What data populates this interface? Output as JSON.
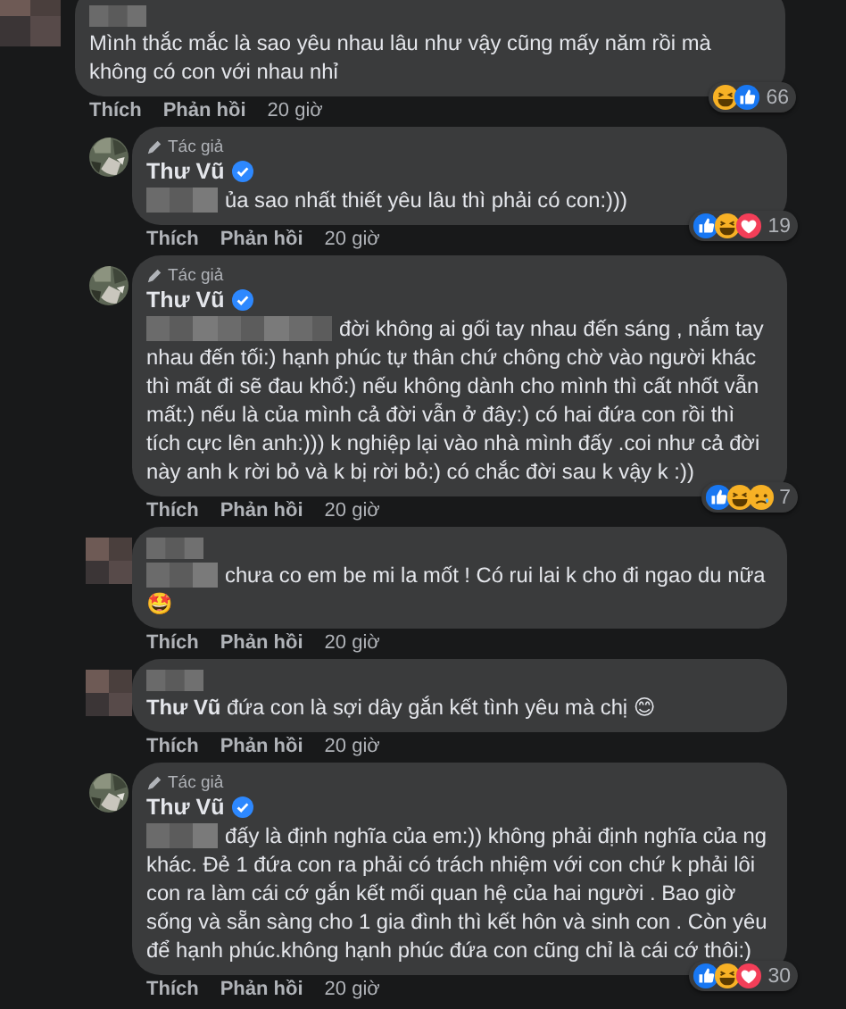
{
  "comments": [
    {
      "kind": "top",
      "avatar": {
        "kind": "mosaic"
      },
      "name_mosaic": true,
      "verified": false,
      "text": "Mình thắc mắc là sao yêu nhau lâu như vậy cũng mấy năm rồi mà không có con với nhau nhỉ",
      "reactions": [
        {
          "kind": "haha"
        },
        {
          "kind": "like"
        }
      ],
      "reaction_count": "66",
      "actions": [
        "Thích",
        "Phản hồi",
        "20 giờ"
      ]
    },
    {
      "kind": "reply",
      "name_mosaic": false,
      "author": "Thư Vũ",
      "author_badge": "Tác giả",
      "verified": true,
      "text_mosaic": {
        "kind": "short"
      },
      "text": "ủa sao nhất thiết yêu lâu thì phải có con:)))",
      "reactions": [
        {
          "kind": "like"
        },
        {
          "kind": "haha"
        },
        {
          "kind": "love"
        }
      ],
      "reaction_count": "19",
      "actions": [
        "Thích",
        "Phản hồi",
        "20 giờ"
      ]
    },
    {
      "kind": "reply",
      "name_mosaic": false,
      "author": "Thư Vũ",
      "author_badge": "Tác giả",
      "verified": true,
      "text_mosaic": {
        "kind": "long"
      },
      "text": "đời không ai gối tay nhau đến sáng , nắm tay nhau đến tối:) hạnh phúc tự thân chứ chông chờ vào người khác thì mất đi sẽ đau khổ:) nếu không dành cho mình thì cất nhốt vẫn mất:) nếu là của mình cả đời vẫn ở đây:) có hai đứa con rồi thì tích cực lên anh:))) k nghiệp lại vào nhà mình đấy .coi như cả đời này anh k rời bỏ và k bị rời bỏ:) có chắc đời sau k vậy k :))",
      "reactions": [
        {
          "kind": "like"
        },
        {
          "kind": "haha"
        },
        {
          "kind": "sad"
        }
      ],
      "reaction_count": "7",
      "actions": [
        "Thích",
        "Phản hồi",
        "20 giờ"
      ]
    },
    {
      "kind": "reply",
      "avatar": {
        "kind": "mosaic"
      },
      "name_mosaic": true,
      "verified": false,
      "text_mosaic": {
        "kind": "short"
      },
      "text": "chưa co em be mi la mốt ! Có rui lai k cho đi ngao du nữa🤩",
      "actions": [
        "Thích",
        "Phản hồi",
        "20 giờ"
      ]
    },
    {
      "kind": "reply",
      "avatar": {
        "kind": "mosaic"
      },
      "name_mosaic": true,
      "verified": false,
      "text": "**Thư Vũ** đứa con là sợi dây gắn kết tình yêu mà chị 😊",
      "actions": [
        "Thích",
        "Phản hồi",
        "20 giờ"
      ]
    },
    {
      "kind": "reply",
      "name_mosaic": false,
      "author": "Thư Vũ",
      "author_badge": "Tác giả",
      "verified": true,
      "text_mosaic": {
        "kind": "short"
      },
      "text": "đấy là định nghĩa của em:)) không phải định nghĩa của ng khác. Đẻ 1 đứa con ra phải có trách nhiệm với con chứ k phải lôi con ra làm cái cớ gắn kết mối quan hệ của hai người . Bao giờ sống và sẵn sàng cho 1 gia đình thì kết hôn và sinh con . Còn yêu để hạnh phúc.không hạnh phúc đứa con cũng chỉ là cái cớ thôi:)",
      "reactions": [
        {
          "kind": "like"
        },
        {
          "kind": "haha"
        },
        {
          "kind": "love"
        }
      ],
      "reaction_count": "30",
      "actions": [
        "Thích",
        "Phản hồi",
        "20 giờ"
      ]
    }
  ]
}
